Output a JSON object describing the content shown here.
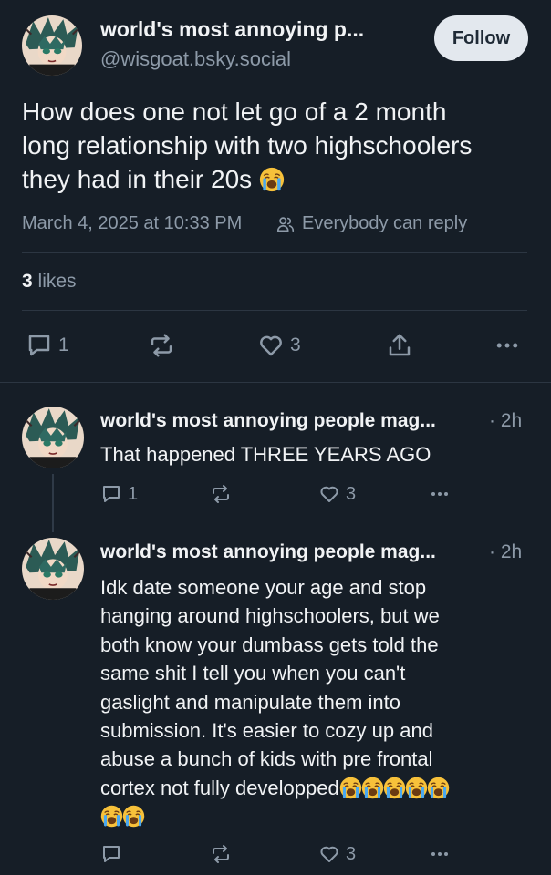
{
  "post": {
    "author_name": "world's most annoying p...",
    "handle": "@wisgoat.bsky.social",
    "follow_label": "Follow",
    "text_lines": [
      "How does one not let go of a 2 month",
      "long relationship with two highschoolers",
      "they had in their 20s"
    ],
    "emoji": "loudly-crying-face",
    "timestamp": "March 4, 2025 at 10:33 PM",
    "reply_setting": "Everybody can reply",
    "likes_count": "3",
    "likes_label": "likes",
    "actions": {
      "reply_count": "1",
      "like_count": "3"
    }
  },
  "replies": [
    {
      "author_name": "world's most annoying people mag...",
      "time": "· 2h",
      "text": "That happened THREE YEARS AGO",
      "reply_count": "1",
      "like_count": "3"
    },
    {
      "author_name": "world's most annoying people mag...",
      "time": "· 2h",
      "text_lines": [
        "Idk date someone your age and stop",
        "hanging around highschoolers, but we",
        "both know your dumbass gets told the",
        "same shit I tell you when you can't",
        "gaslight and manipulate them into",
        "submission. It's easier to cozy up and",
        "abuse a bunch of kids with pre frontal",
        "cortex not fully developped"
      ],
      "emoji": "loudly-crying-face",
      "like_count": "3"
    }
  ],
  "colors": {
    "background": "#161e27",
    "text": "#f1f3f5",
    "muted": "#8d9aa8",
    "divider": "#2c3642",
    "follow_button": "#e3e8ee"
  }
}
